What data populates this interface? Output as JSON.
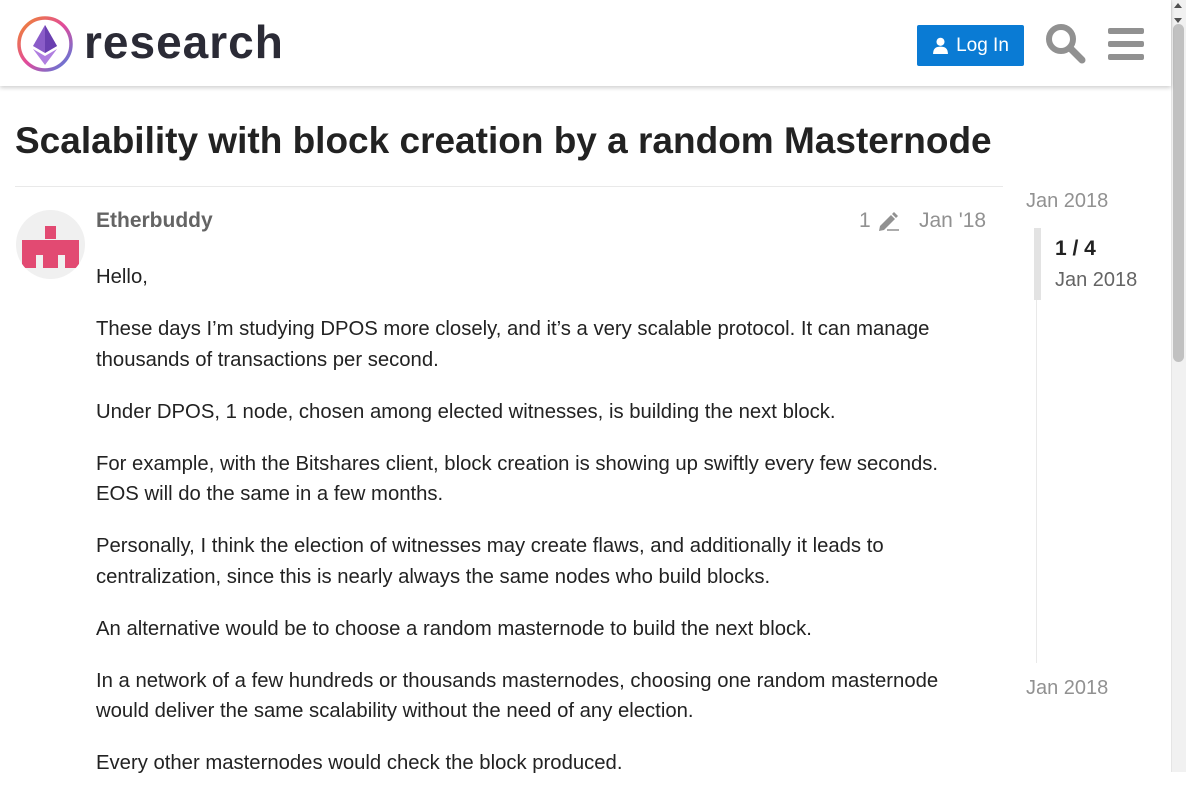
{
  "header": {
    "site_name": "research",
    "login_label": "Log In",
    "icons": {
      "logo": "ethereum-research-logo",
      "login": "user-icon",
      "search": "search-icon",
      "menu": "hamburger-menu-icon"
    },
    "colors": {
      "login_bg": "#0a7bd4",
      "icon": "#919191"
    }
  },
  "topic": {
    "title": "Scalability with block creation by a random Masternode"
  },
  "post": {
    "username": "Etherbuddy",
    "edit_count": "1",
    "date": "Jan '18",
    "paragraphs": [
      "Hello,",
      "These days I’m studying DPOS more closely, and it’s a very scalable protocol. It can manage thousands of transactions per second.",
      "Under DPOS, 1 node, chosen among elected witnesses, is building the next block.",
      "For example, with the Bitshares client, block creation is showing up swiftly every few seconds. EOS will do the same in a few months.",
      "Personally, I think the election of witnesses may create flaws, and additionally it leads to centralization, since this is nearly always the same nodes who build blocks.",
      "An alternative would be to choose a random masternode to build the next block.",
      "In a network of a few hundreds or thousands masternodes, choosing one random masternode would deliver the same scalability without the need of any election.",
      "Every other masternodes would check the block produced."
    ],
    "icons": {
      "avatar": "identicon-avatar",
      "edit": "pencil-icon"
    },
    "colors": {
      "avatar": "#e24a72"
    }
  },
  "timeline": {
    "start_date": "Jan 2018",
    "position": "1 / 4",
    "current_date": "Jan 2018",
    "end_date": "Jan 2018"
  }
}
